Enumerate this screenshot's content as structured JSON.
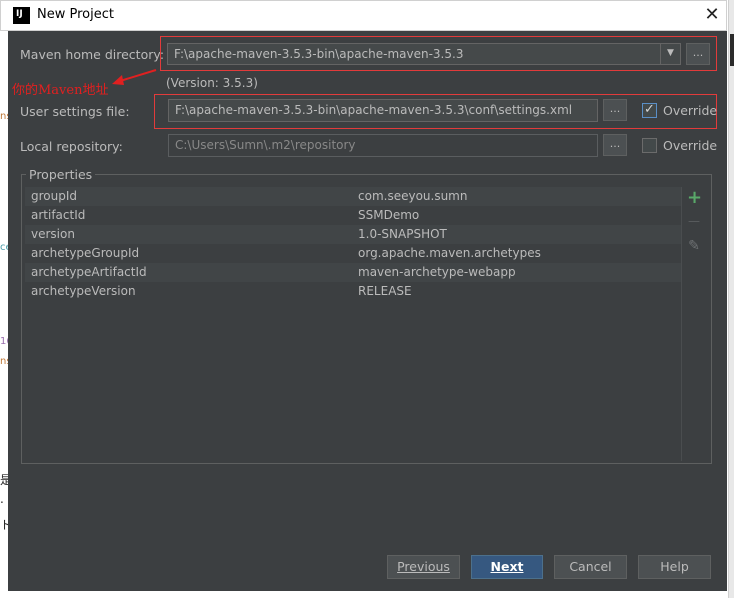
{
  "window": {
    "title": "New Project",
    "app_icon_text": "IJ",
    "close_glyph": "✕"
  },
  "form": {
    "maven_home_label": "Maven home directory:",
    "maven_home_value": "F:\\apache-maven-3.5.3-bin\\apache-maven-3.5.3",
    "version_text": "(Version: 3.5.3)",
    "user_settings_label": "User settings file:",
    "user_settings_value": "F:\\apache-maven-3.5.3-bin\\apache-maven-3.5.3\\conf\\settings.xml",
    "user_settings_override": "Override",
    "user_settings_override_checked": true,
    "local_repo_label": "Local repository:",
    "local_repo_value": "C:\\Users\\Sumn\\.m2\\repository",
    "local_repo_override": "Override",
    "local_repo_override_checked": false,
    "browse_label": "..."
  },
  "annotation": {
    "text": "你的Maven地址",
    "color": "#e02020"
  },
  "properties": {
    "title": "Properties",
    "rows": [
      {
        "key": "groupId",
        "value": "com.seeyou.sumn"
      },
      {
        "key": "artifactId",
        "value": "SSMDemo"
      },
      {
        "key": "version",
        "value": "1.0-SNAPSHOT"
      },
      {
        "key": "archetypeGroupId",
        "value": "org.apache.maven.archetypes"
      },
      {
        "key": "archetypeArtifactId",
        "value": "maven-archetype-webapp"
      },
      {
        "key": "archetypeVersion",
        "value": "RELEASE"
      }
    ],
    "tools": {
      "add": "+",
      "remove": "—",
      "edit": "✎"
    }
  },
  "buttons": {
    "previous": "Previous",
    "next": "Next",
    "cancel": "Cancel",
    "help": "Help"
  },
  "colors": {
    "dialog_bg": "#3c3f41",
    "accent_blue": "#365880",
    "highlight_red": "#e23b3b",
    "add_green": "#59a869"
  }
}
